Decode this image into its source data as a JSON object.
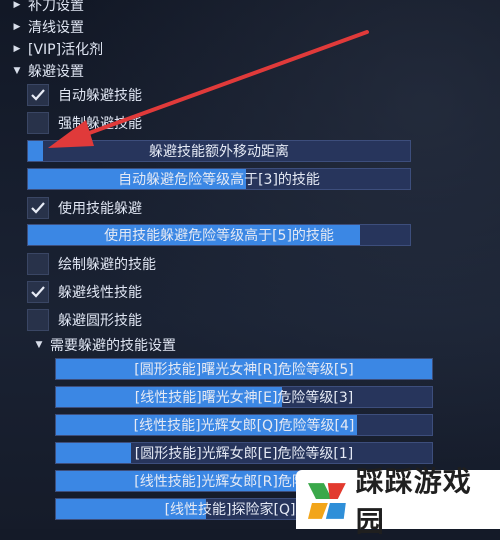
{
  "tree": [
    {
      "label": "补刀设置",
      "expanded": false
    },
    {
      "label": "清线设置",
      "expanded": false
    },
    {
      "label": "[VIP]活化剂",
      "expanded": false
    },
    {
      "label": "躲避设置",
      "expanded": true
    }
  ],
  "options": {
    "auto_dodge": {
      "label": "自动躲避技能",
      "checked": true
    },
    "force_dodge": {
      "label": "强制躲避技能",
      "checked": false
    },
    "extra_distance": {
      "label": "躲避技能额外移动距离",
      "level": 0.04
    },
    "auto_dodge_danger": {
      "label": "自动躲避危险等级高于[3]的技能",
      "level": 0.57
    },
    "skill_dodge": {
      "label": "使用技能躲避",
      "checked": true
    },
    "skill_dodge_danger": {
      "label": "使用技能躲避危险等级高于[5]的技能",
      "level": 0.87
    },
    "draw_skills": {
      "label": "绘制躲避的技能",
      "checked": false
    },
    "dodge_linear": {
      "label": "躲避线性技能",
      "checked": true
    },
    "dodge_circular": {
      "label": "躲避圆形技能",
      "checked": false
    }
  },
  "subsection": {
    "label": "需要躲避的技能设置",
    "expanded": true
  },
  "skills": [
    {
      "label": "[圆形技能]曙光女神[R]危险等级[5]",
      "level": 1.0
    },
    {
      "label": "[线性技能]曙光女神[E]危险等级[3]",
      "level": 0.6
    },
    {
      "label": "[线性技能]光辉女郎[Q]危险等级[4]",
      "level": 0.8
    },
    {
      "label": "[圆形技能]光辉女郎[E]危险等级[1]",
      "level": 0.2
    },
    {
      "label": "[线性技能]光辉女郎[R]危险等级[4]",
      "level": 0.8
    },
    {
      "label": "[线性技能]探险家[Q]危险",
      "level": 0.4
    }
  ],
  "watermark": {
    "text": "踩踩游戏园"
  },
  "colors": {
    "accent": "#3b87e4",
    "track": "#27355c",
    "arrow": "#e03a3a"
  }
}
